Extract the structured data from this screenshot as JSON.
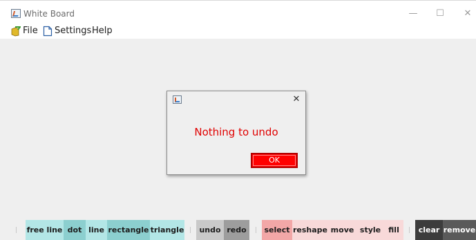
{
  "window": {
    "title": "White Board",
    "controls": {
      "minimize": "—",
      "maximize": "☐",
      "close": "✕"
    }
  },
  "menu": {
    "items": [
      {
        "label": "File",
        "icon": "folder-arrow-icon"
      },
      {
        "label": "Settings",
        "icon": "document-icon"
      },
      {
        "label": "Help"
      }
    ]
  },
  "dialog": {
    "message": "Nothing to undo",
    "ok_label": "OK",
    "close": "✕"
  },
  "toolbar": {
    "separator": "|",
    "draw_tools": [
      "free line",
      "dot",
      "line",
      "rectangle",
      "triangle"
    ],
    "history_tools": [
      "undo",
      "redo"
    ],
    "edit_tools": [
      "select",
      "reshape",
      "move",
      "style",
      "fill"
    ],
    "canvas_tools": [
      "clear",
      "remove"
    ]
  },
  "colors": {
    "draw_light": "#b3e6e6",
    "draw_dark": "#8ccfcf",
    "history_light": "#c9c9c9",
    "history_dark": "#9d9d9d",
    "edit_accent": "#f2a7a7",
    "edit_light": "#f8d9d9",
    "canvas_dark": "#3c3c3c",
    "canvas_mid": "#5a5a5a",
    "dialog_text": "#e00000",
    "ok_button": "#ff0000"
  }
}
